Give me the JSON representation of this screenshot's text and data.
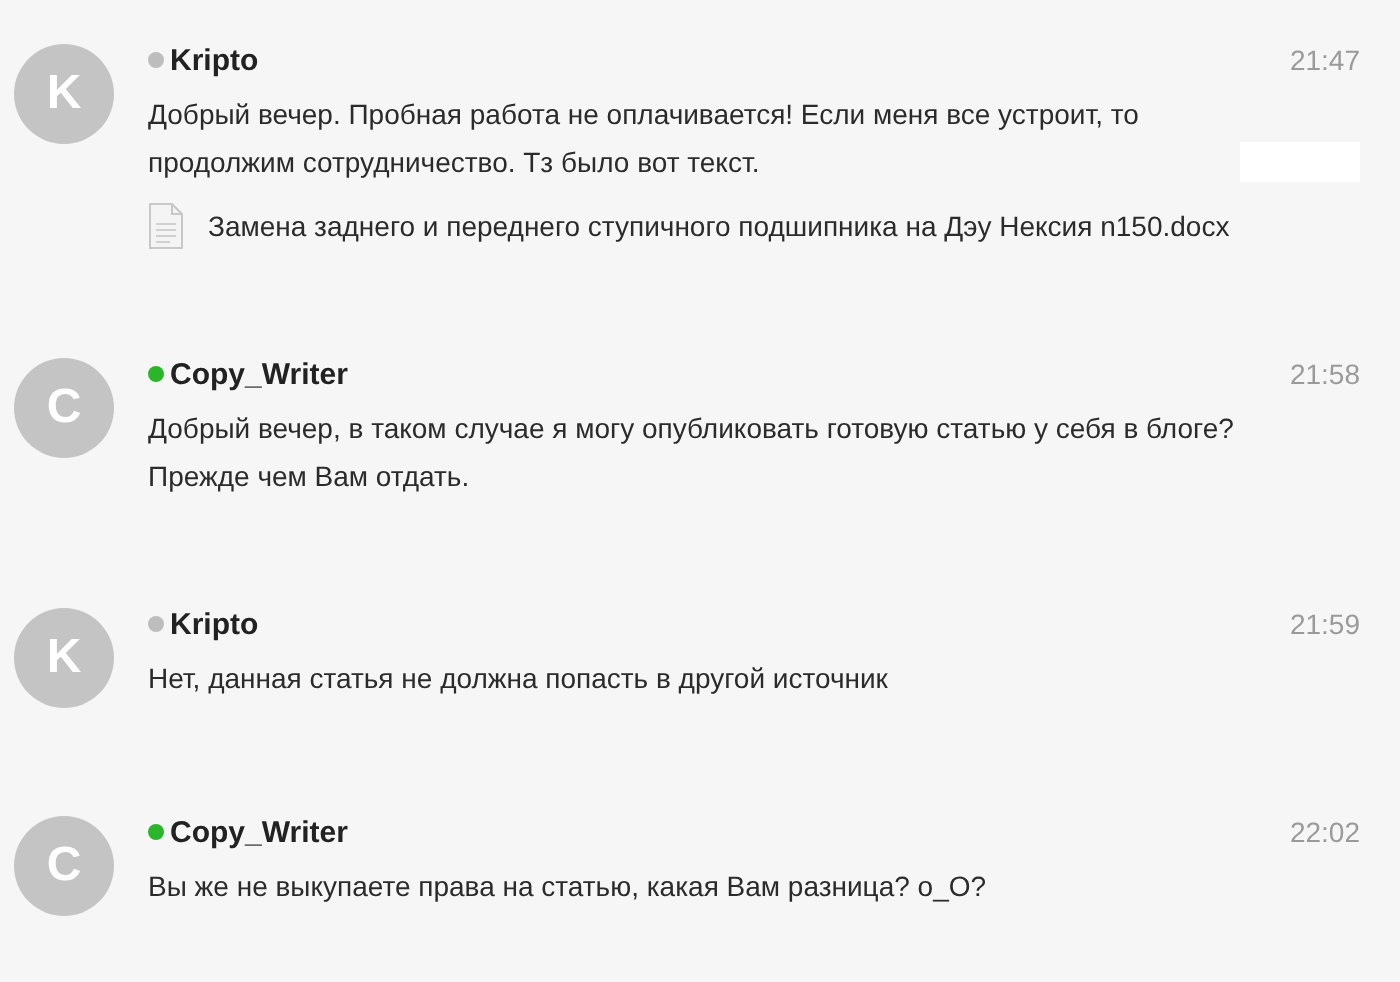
{
  "messages": [
    {
      "avatar": "K",
      "author": "Kripto",
      "online": false,
      "time": "21:47",
      "text": [
        "Добрый вечер. Пробная работа не оплачивается! Если меня все устроит, то",
        "продолжим сотрудничество. Тз было  вот текст."
      ],
      "attachment": "Замена заднего и переднего ступичного подшипника на Дэу Нексия n150.docx"
    },
    {
      "avatar": "C",
      "author": "Copy_Writer",
      "online": true,
      "time": "21:58",
      "text": [
        "Добрый вечер, в таком случае я могу опубликовать готовую статью у себя в блоге?",
        "Прежде чем Вам отдать."
      ]
    },
    {
      "avatar": "K",
      "author": "Kripto",
      "online": false,
      "time": "21:59",
      "text": [
        "Нет, данная статья не должна попасть в другой источник"
      ]
    },
    {
      "avatar": "C",
      "author": "Copy_Writer",
      "online": true,
      "time": "22:02",
      "text": [
        "Вы же не выкупаете права на статью, какая Вам разница? о_О?"
      ]
    }
  ]
}
